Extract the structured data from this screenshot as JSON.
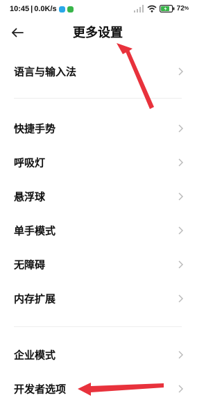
{
  "status_bar": {
    "time": "10:45",
    "separator": "|",
    "network_speed": "0.0K/s",
    "battery_level": "72",
    "icons": [
      "cloud-app-icon",
      "green-app-icon",
      "signal-icon",
      "wifi-icon",
      "battery-icon"
    ]
  },
  "header": {
    "title": "更多设置",
    "back_icon": "back-arrow-icon"
  },
  "sections": [
    {
      "items": [
        {
          "label": "语言与输入法"
        }
      ]
    },
    {
      "items": [
        {
          "label": "快捷手势"
        },
        {
          "label": "呼吸灯"
        },
        {
          "label": "悬浮球"
        },
        {
          "label": "单手模式"
        },
        {
          "label": "无障碍"
        },
        {
          "label": "内存扩展"
        }
      ]
    },
    {
      "items": [
        {
          "label": "企业模式"
        },
        {
          "label": "开发者选项"
        }
      ]
    }
  ],
  "colors": {
    "annotation_arrow": "#e8323c",
    "chevron": "#b8b8b8",
    "divider": "#ededed",
    "text": "#111111"
  }
}
